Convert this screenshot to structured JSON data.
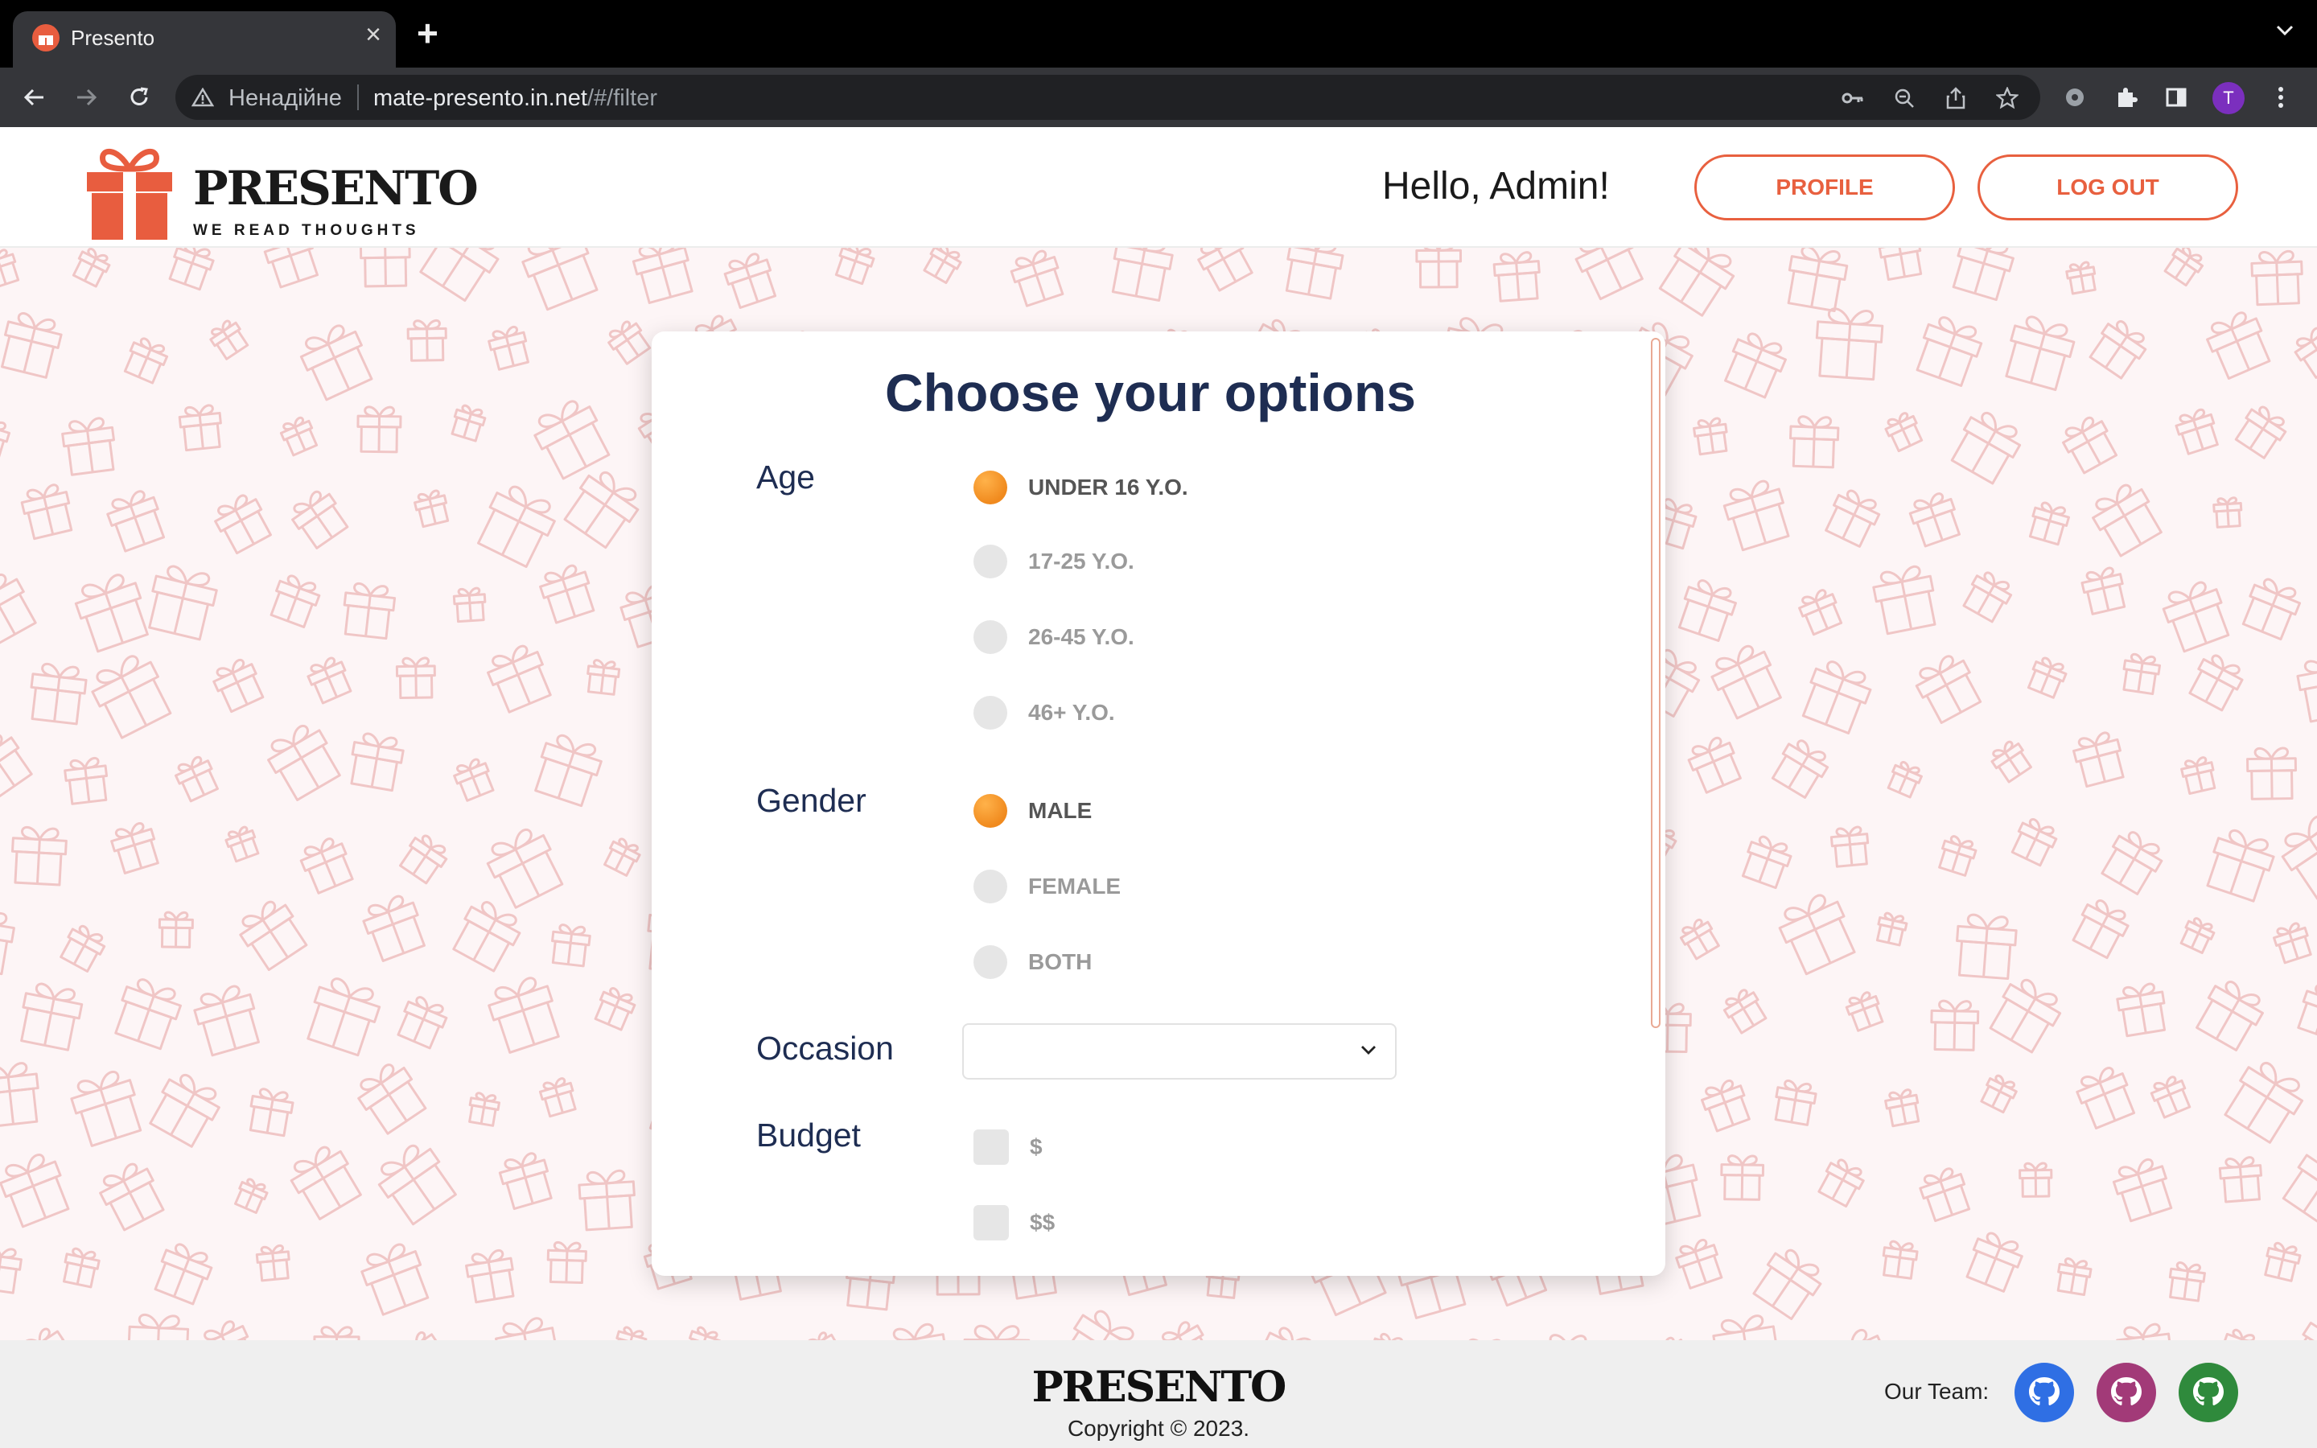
{
  "browser": {
    "tab_title": "Presento",
    "insecure_label": "Ненадійне",
    "url_host": "mate-presento.in.net",
    "url_path": "/#/filter",
    "profile_initial": "T"
  },
  "header": {
    "brand": "PRESENTO",
    "tagline": "WE READ THOUGHTS",
    "greeting": "Hello, Admin!",
    "profile_button": "PROFILE",
    "logout_button": "LOG OUT"
  },
  "form": {
    "title": "Choose your options",
    "age": {
      "label": "Age",
      "options": [
        {
          "label": "UNDER 16 Y.O.",
          "selected": true
        },
        {
          "label": "17-25 Y.O.",
          "selected": false
        },
        {
          "label": "26-45 Y.O.",
          "selected": false
        },
        {
          "label": "46+ Y.O.",
          "selected": false
        }
      ]
    },
    "gender": {
      "label": "Gender",
      "options": [
        {
          "label": "MALE",
          "selected": true
        },
        {
          "label": "FEMALE",
          "selected": false
        },
        {
          "label": "BOTH",
          "selected": false
        }
      ]
    },
    "occasion": {
      "label": "Occasion",
      "value": ""
    },
    "budget": {
      "label": "Budget",
      "options": [
        {
          "label": "$",
          "checked": false
        },
        {
          "label": "$$",
          "checked": false
        }
      ]
    }
  },
  "footer": {
    "brand": "PRESENTO",
    "copyright": "Copyright © 2023.",
    "team_label": "Our Team:",
    "team": [
      {
        "icon": "github-icon",
        "color": "#2f6fe4"
      },
      {
        "icon": "github-icon",
        "color": "#a23a78"
      },
      {
        "icon": "github-icon",
        "color": "#2f8a3c"
      }
    ]
  },
  "colors": {
    "accent": "#e8603f",
    "selected_radio": "#f39a2c",
    "heading": "#1e2d52",
    "page_bg": "#fdf5f6"
  }
}
